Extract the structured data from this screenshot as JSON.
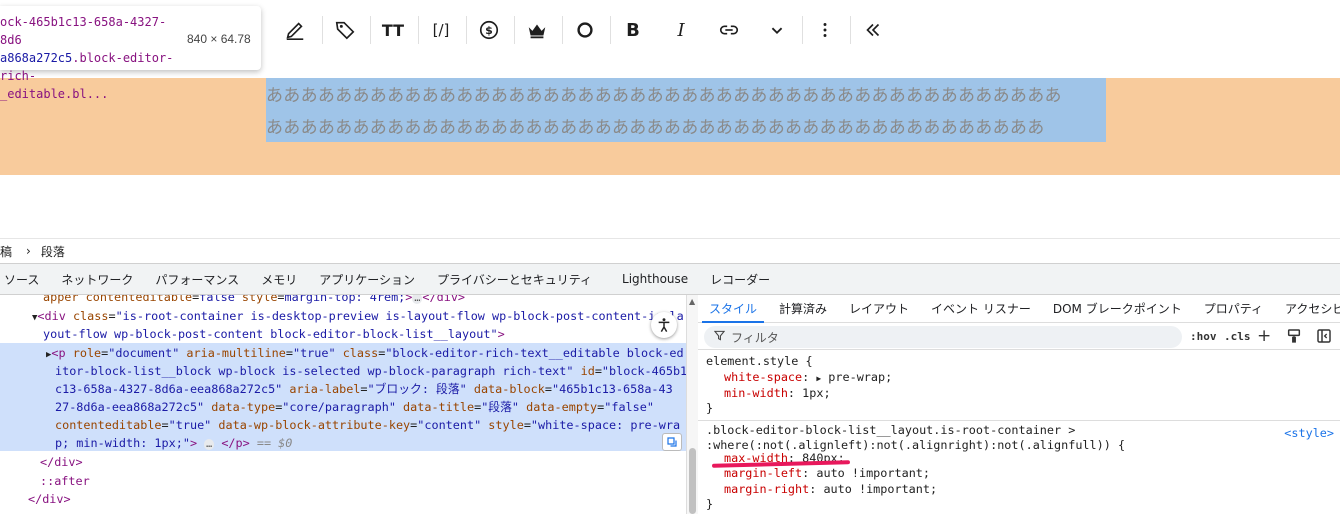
{
  "tooltip": {
    "selector_line1": "ock-465b1c13-658a-4327-8d6",
    "selector_line2": "a868a272c5",
    "selector_line2b": ".block-editor-rich-",
    "selector_line3": "_editable.bl...",
    "dimensions": "840 × 64.78"
  },
  "toolbar": {
    "icons": [
      "pen-icon",
      "tag-icon",
      "text-size-icon",
      "shortcode-icon",
      "dollar-icon",
      "crown-icon",
      "circle-icon",
      "bold-icon",
      "italic-icon",
      "link-icon",
      "chevron-down-icon",
      "more-vertical-icon",
      "collapse-icon"
    ],
    "text_size": "TT",
    "shortcode": "[/]",
    "bold": "B",
    "italic": "I"
  },
  "paragraph": {
    "line1": "ああああああああああああああああああああああああああああああああああああああああああああああ",
    "line2": "あああああああああああああああああああああああああああああああああああああああああああああ"
  },
  "breadcrumb": {
    "item1": "稿",
    "item2": "段落"
  },
  "devtools": {
    "tabs": [
      "ソース",
      "ネットワーク",
      "パフォーマンス",
      "メモリ",
      "アプリケーション",
      "プライバシーとセキュリティ",
      "Lighthouse",
      "レコーダー"
    ],
    "elements": {
      "l0_a": "apper",
      "l0_b": "contenteditable",
      "l0_c": "false",
      "l0_d": "style",
      "l0_e": "margin-top: 4rem;",
      "l0_f": "</div>",
      "l1_tag": "<div",
      "l1_attr": "class",
      "l1_val": "\"is-root-container is-desktop-preview is-layout-flow wp-block-post-content-is-la",
      "l2_val": "yout-flow wp-block-post-content block-editor-block-list__layout\"",
      "l2_end": ">",
      "p1_tag": "<p",
      "p1_a1": "role",
      "p1_v1": "\"document\"",
      "p1_a2": "aria-multiline",
      "p1_v2": "\"true\"",
      "p1_a3": "class",
      "p1_v3": "\"block-editor-rich-text__editable block-ed",
      "p2_v": "itor-block-list__block wp-block is-selected wp-block-paragraph rich-text\"",
      "p2_a": "id",
      "p2_v2": "\"block-465b1",
      "p3_v": "c13-658a-4327-8d6a-eea868a272c5\"",
      "p3_a": "aria-label",
      "p3_v2": "\"ブロック: 段落\"",
      "p3_a2": "data-block",
      "p3_v3": "\"465b1c13-658a-43",
      "p4_v": "27-8d6a-eea868a272c5\"",
      "p4_a": "data-type",
      "p4_v2": "\"core/paragraph\"",
      "p4_a2": "data-title",
      "p4_v3": "\"段落\"",
      "p4_a3": "data-empty",
      "p4_v4": "\"false\"",
      "p5_a": "contenteditable",
      "p5_v": "\"true\"",
      "p5_a2": "data-wp-block-attribute-key",
      "p5_v2": "\"content\"",
      "p5_a3": "style",
      "p5_v3": "\"white-space: pre-wra",
      "p6_v": "p; min-width: 1px;\"",
      "p6_end": "</p>",
      "p6_dollar": "== $0",
      "close_div": "</div>",
      "after": "::after",
      "close_div2": "</div>",
      "ellipsis": "…"
    },
    "styles_tabs": [
      "スタイル",
      "計算済み",
      "レイアウト",
      "イベント リスナー",
      "DOM ブレークポイント",
      "プロパティ",
      "アクセシビリティ"
    ],
    "filter_placeholder": "フィルタ",
    "hov": ":hov",
    "cls": ".cls",
    "rule1": {
      "selector": "element.style",
      "p1": "white-space",
      "v1": "pre-wrap",
      "p2": "min-width",
      "v2": "1px"
    },
    "rule2": {
      "selector1": ".block-editor-block-list__layout.is-root-container >",
      "selector2": ":where(:not(.alignleft):not(.alignright):not(.alignfull))",
      "source": "<style>",
      "p1": "max-width",
      "v1": "840px",
      "p2": "margin-left",
      "v2": "auto !important",
      "p3": "margin-right",
      "v3": "auto !important"
    }
  },
  "colors": {
    "band": "#f8cb9c",
    "selection": "#9fc4e8",
    "accent": "#1a73e8",
    "annotation": "#e8185c"
  }
}
